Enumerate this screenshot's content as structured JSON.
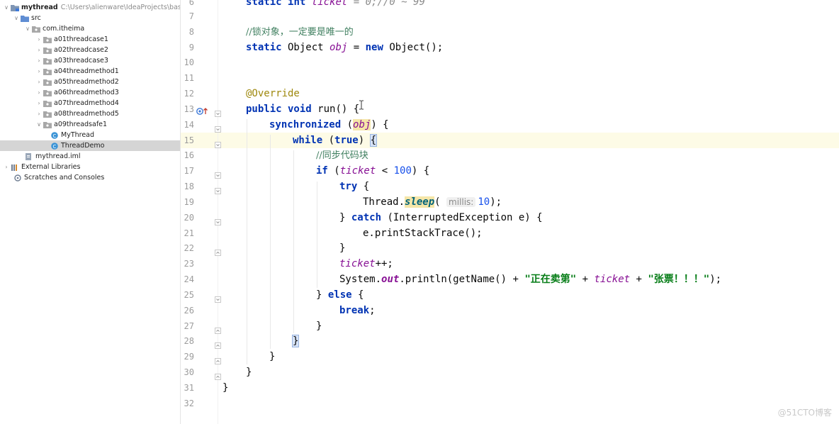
{
  "project_tree": {
    "root": {
      "name": "mythread",
      "path": "C:\\Users\\alienware\\IdeaProjects\\basic-"
    },
    "src": "src",
    "package": "com.itheima",
    "subpackages": [
      "a01threadcase1",
      "a02threadcase2",
      "a03threadcase3",
      "a04threadmethod1",
      "a05threadmethod2",
      "a06threadmethod3",
      "a07threadmethod4",
      "a08threadmethod5",
      "a09threadsafe1"
    ],
    "classes": [
      "MyThread",
      "ThreadDemo"
    ],
    "iml_file": "mythread.iml",
    "external_libraries": "External Libraries",
    "scratches": "Scratches and Consoles"
  },
  "editor": {
    "line_numbers": [
      "6",
      "7",
      "8",
      "9",
      "10",
      "11",
      "12",
      "13",
      "14",
      "15",
      "16",
      "17",
      "18",
      "19",
      "20",
      "21",
      "22",
      "23",
      "24",
      "25",
      "26",
      "27",
      "28",
      "29",
      "30",
      "31",
      "32"
    ],
    "lines": {
      "l6_kw1": "static",
      "l6_kw2": "int",
      "l6_field": "ticket",
      "l6_rest": " = 0;//0 ~ 99",
      "l8_comment": "//锁对象，一定要是唯一的",
      "l9_kw1": "static",
      "l9_type": " Object ",
      "l9_field": "obj",
      "l9_eq": " = ",
      "l9_kw2": "new",
      "l9_rest": " Object();",
      "l12_annotation": "@Override",
      "l13_kw1": "public",
      "l13_kw2": " void",
      "l13_rest": " run() {",
      "l14_kw": "synchronized",
      "l14_open": " (",
      "l14_field": "obj",
      "l14_close": ") {",
      "l15_kw": "while",
      "l15_open": " (",
      "l15_kw2": "true",
      "l15_close": ") ",
      "l15_brace": "{",
      "l16_comment": "//同步代码块",
      "l17_kw": "if",
      "l17_open": " (",
      "l17_field": "ticket",
      "l17_lt": " < ",
      "l17_num": "100",
      "l17_close": ") {",
      "l18_kw": "try",
      "l18_rest": " {",
      "l19_cls": "Thread.",
      "l19_method": "sleep",
      "l19_open": "( ",
      "l19_hint": "millis:",
      "l19_num": "10",
      "l19_close": ");",
      "l20_open": "} ",
      "l20_kw": "catch",
      "l20_rest": " (InterruptedException e) {",
      "l21_text": "e.printStackTrace();",
      "l22_text": "}",
      "l23_field": "ticket",
      "l23_rest": "++;",
      "l24_sys": "System.",
      "l24_out": "out",
      "l24_mid": ".println(getName() + ",
      "l24_str1": "\"正在卖第\"",
      "l24_plus": " + ",
      "l24_field": "ticket",
      "l24_plus2": " + ",
      "l24_str2": "\"张票！！！\"",
      "l24_close": ");",
      "l25_open": "} ",
      "l25_kw": "else",
      "l25_rest": " {",
      "l26_kw": "break",
      "l26_rest": ";",
      "l27_text": "}",
      "l28_text": "}",
      "l29_text": "}",
      "l30_text": "}",
      "l31_text": "}"
    }
  },
  "watermark": "@51CTO博客",
  "colors": {
    "keyword": "#0033b3",
    "field": "#871094",
    "number": "#1750eb",
    "string": "#067d17",
    "annotation": "#9e880d",
    "comment": "#8c8c8c",
    "caret_row": "#fdfbe6",
    "selection": "#d5d5d5"
  },
  "icons": [
    "folder-icon",
    "package-icon",
    "java-class-icon",
    "module-icon",
    "libraries-icon",
    "scratches-icon",
    "override-marker-icon",
    "fold-marker-icon",
    "text-cursor-icon"
  ]
}
